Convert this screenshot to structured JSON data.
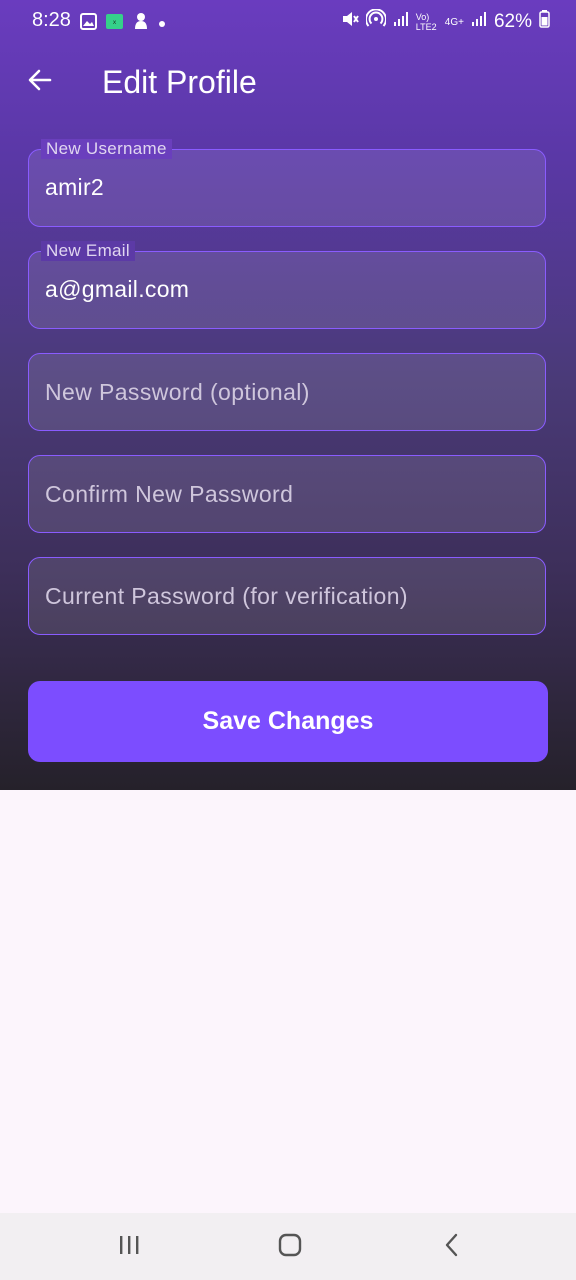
{
  "status_bar": {
    "time": "8:28",
    "battery": "62%",
    "network": "4G+",
    "volte": "Vo) LTE2",
    "left_icons": [
      "image-icon",
      "app-notification-icon",
      "pet-icon",
      "dot-icon"
    ],
    "right_icons": [
      "mute-icon",
      "hotspot-icon",
      "signal-icon",
      "signal-icon",
      "battery-icon"
    ]
  },
  "app_bar": {
    "title": "Edit Profile",
    "back_icon": "arrow-back-icon"
  },
  "form": {
    "username": {
      "label": "New Username",
      "value": "amir2"
    },
    "email": {
      "label": "New Email",
      "value": "a@gmail.com"
    },
    "new_password": {
      "placeholder": "New Password (optional)"
    },
    "confirm_password": {
      "placeholder": "Confirm New Password"
    },
    "current_password": {
      "placeholder": "Current Password (for verification)"
    },
    "save_label": "Save Changes"
  },
  "nav_bar": {
    "icons": [
      "recent-apps-icon",
      "home-icon",
      "back-icon"
    ]
  },
  "colors": {
    "accent": "#7c4dff",
    "field_border": "#8a5cff",
    "gradient_top": "#6a3cbf",
    "gradient_bottom": "#25212a",
    "page_background": "#fcf5fc"
  }
}
